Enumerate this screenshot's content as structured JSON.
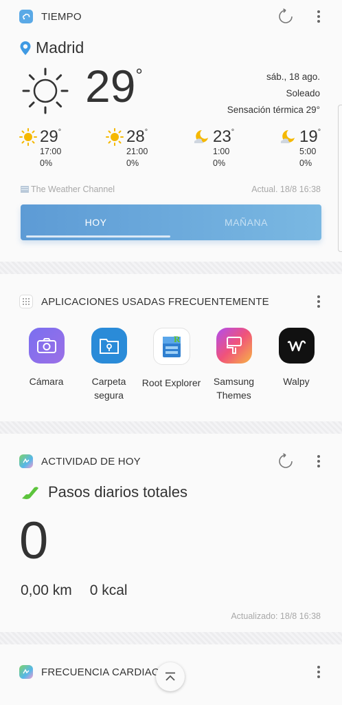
{
  "weather": {
    "title": "TIEMPO",
    "city": "Madrid",
    "current_temp": "29",
    "degree": "°",
    "date": "sáb., 18 ago.",
    "condition": "Soleado",
    "feels_like": "Sensación térmica 29°",
    "forecast": [
      {
        "temp": "29",
        "time": "17:00",
        "precip": "0%",
        "icon": "sun-icon"
      },
      {
        "temp": "28",
        "time": "21:00",
        "precip": "0%",
        "icon": "sun-icon"
      },
      {
        "temp": "23",
        "time": "1:00",
        "precip": "0%",
        "icon": "moon-cloud-icon"
      },
      {
        "temp": "19",
        "time": "5:00",
        "precip": "0%",
        "icon": "moon-cloud-icon"
      }
    ],
    "provider": "The Weather Channel",
    "updated": "Actual. 18/8 16:38",
    "tabs": {
      "today": "HOY",
      "tomorrow": "MAÑANA"
    }
  },
  "apps": {
    "title": "APLICACIONES USADAS FRECUENTEMENTE",
    "items": [
      {
        "label": "Cámara",
        "icon": "camera-app-icon"
      },
      {
        "label": "Carpeta segura",
        "icon": "secure-folder-app-icon"
      },
      {
        "label": "Root Explorer",
        "icon": "root-explorer-app-icon"
      },
      {
        "label": "Samsung Themes",
        "icon": "samsung-themes-app-icon"
      },
      {
        "label": "Walpy",
        "icon": "walpy-app-icon"
      }
    ]
  },
  "activity": {
    "title": "ACTIVIDAD DE HOY",
    "steps_label": "Pasos diarios totales",
    "steps": "0",
    "distance": "0,00 km",
    "calories": "0 kcal",
    "updated": "Actualizado: 18/8 16:38"
  },
  "heart": {
    "title": "FRECUENCIA CARDIACA"
  },
  "colors": {
    "accent_blue": "#5d9bd5",
    "sun_yellow": "#f5b800",
    "steps_green": "#5cc43c"
  }
}
